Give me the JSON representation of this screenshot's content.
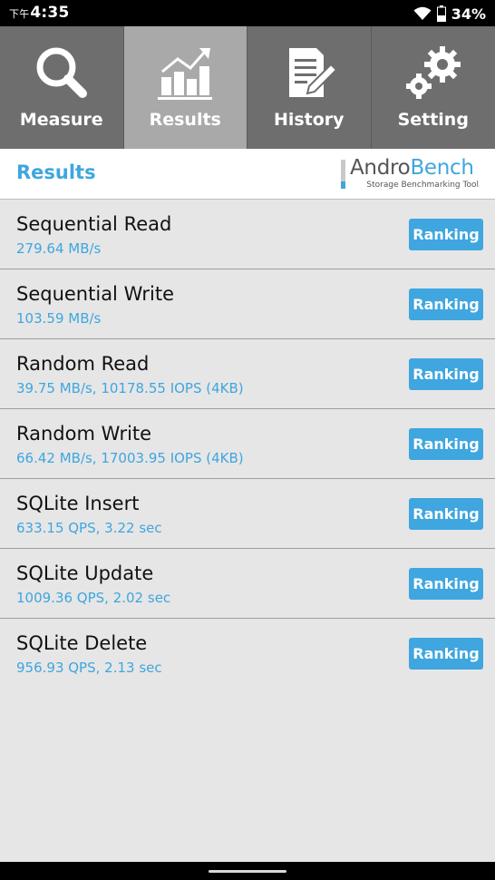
{
  "status_bar": {
    "ampm": "下午",
    "time": "4:35",
    "battery_percent": "34%",
    "icons": [
      "wifi-icon",
      "battery-icon"
    ]
  },
  "tabs": [
    {
      "label": "Measure",
      "icon": "magnifier-icon",
      "active": false
    },
    {
      "label": "Results",
      "icon": "bar-chart-icon",
      "active": true
    },
    {
      "label": "History",
      "icon": "clipboard-icon",
      "active": false
    },
    {
      "label": "Setting",
      "icon": "gears-icon",
      "active": false
    }
  ],
  "header": {
    "title": "Results",
    "logo": {
      "andro": "Andro",
      "bench": "Bench",
      "subtitle": "Storage Benchmarking Tool"
    }
  },
  "results": [
    {
      "name": "Sequential Read",
      "value": "279.64 MB/s",
      "button": "Ranking"
    },
    {
      "name": "Sequential Write",
      "value": "103.59 MB/s",
      "button": "Ranking"
    },
    {
      "name": "Random Read",
      "value": "39.75 MB/s, 10178.55 IOPS (4KB)",
      "button": "Ranking"
    },
    {
      "name": "Random Write",
      "value": "66.42 MB/s, 17003.95 IOPS (4KB)",
      "button": "Ranking"
    },
    {
      "name": "SQLite Insert",
      "value": "633.15 QPS, 3.22 sec",
      "button": "Ranking"
    },
    {
      "name": "SQLite Update",
      "value": "1009.36 QPS, 2.02 sec",
      "button": "Ranking"
    },
    {
      "name": "SQLite Delete",
      "value": "956.93 QPS, 2.13 sec",
      "button": "Ranking"
    }
  ],
  "colors": {
    "accent": "#3fa6df",
    "tab_bg": "#6e6e6e",
    "tab_active_bg": "#a9a9a9",
    "list_bg": "#e6e6e6"
  }
}
